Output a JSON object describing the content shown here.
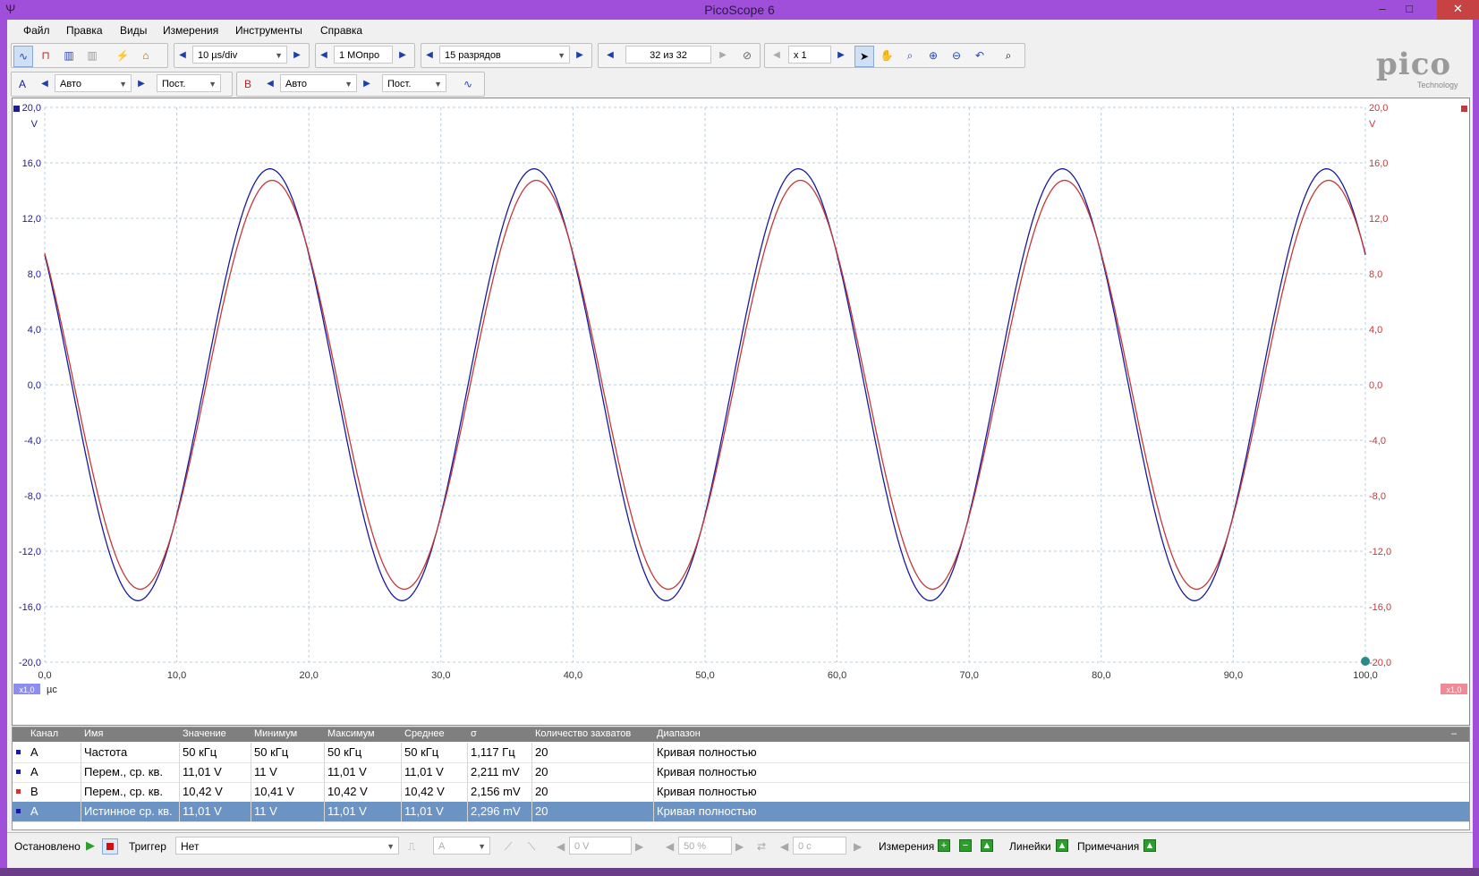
{
  "window": {
    "title": "PicoScope 6"
  },
  "menu": [
    "Файл",
    "Правка",
    "Виды",
    "Измерения",
    "Инструменты",
    "Справка"
  ],
  "toolbar1": {
    "timebase": "10 µs/div",
    "samples": "1 MОпро",
    "resolution": "15 разрядов",
    "buffer": "32 из 32",
    "zoom": "x 1"
  },
  "toolbar2": {
    "channel_a": {
      "label": "A",
      "range": "Авто",
      "coupling": "Пост."
    },
    "channel_b": {
      "label": "B",
      "range": "Авто",
      "coupling": "Пост."
    }
  },
  "logo": {
    "word": "pico",
    "sub": "Technology"
  },
  "plot": {
    "left_unit": "V",
    "right_unit": "V",
    "x_unit": "µс",
    "x_scale_left": "x1,0",
    "x_scale_right": "x1,0",
    "y_ticks": [
      "20,0",
      "16,0",
      "12,0",
      "8,0",
      "4,0",
      "0,0",
      "-4,0",
      "-8,0",
      "-12,0",
      "-16,0",
      "-20,0"
    ],
    "x_ticks": [
      "0,0",
      "10,0",
      "20,0",
      "30,0",
      "40,0",
      "50,0",
      "60,0",
      "70,0",
      "80,0",
      "90,0",
      "100,0"
    ],
    "colors": {
      "channel_a": "#1a1a9c",
      "channel_b": "#c23a3a",
      "grid": "#b8ccd8"
    }
  },
  "chart_data": {
    "type": "line",
    "title": "",
    "xlabel": "µс",
    "ylabel": "V",
    "xlim": [
      0,
      100
    ],
    "ylim": [
      -20,
      20
    ],
    "grid": true,
    "series": [
      {
        "name": "A",
        "color": "#1a1a9c",
        "amplitude": 15.57,
        "frequency_khz": 50,
        "phase_deg": 143,
        "offset": 0
      },
      {
        "name": "B",
        "color": "#c23a3a",
        "amplitude": 14.74,
        "frequency_khz": 50,
        "phase_deg": 140,
        "offset": 0
      }
    ]
  },
  "table": {
    "headers": [
      "Канал",
      "Имя",
      "Значение",
      "Минимум",
      "Максимум",
      "Среднее",
      "σ",
      "Количество захватов",
      "Диапазон"
    ],
    "rows": [
      {
        "channel": "A",
        "name": "Частота",
        "value": "50 кГц",
        "min": "50 кГц",
        "max": "50 кГц",
        "avg": "50 кГц",
        "sigma": "1,117 Гц",
        "count": "20",
        "range": "Кривая полностью",
        "color": "#1a1a9c",
        "selected": false
      },
      {
        "channel": "A",
        "name": "Перем., ср. кв.",
        "value": "11,01 V",
        "min": "11 V",
        "max": "11,01 V",
        "avg": "11,01 V",
        "sigma": "2,211 mV",
        "count": "20",
        "range": "Кривая полностью",
        "color": "#1a1a9c",
        "selected": false
      },
      {
        "channel": "B",
        "name": "Перем., ср. кв.",
        "value": "10,42 V",
        "min": "10,41 V",
        "max": "10,42 V",
        "avg": "10,42 V",
        "sigma": "2,156 mV",
        "count": "20",
        "range": "Кривая полностью",
        "color": "#c23a3a",
        "selected": false
      },
      {
        "channel": "A",
        "name": "Истинное ср. кв.",
        "value": "11,01 V",
        "min": "11 V",
        "max": "11,01 V",
        "avg": "11,01 V",
        "sigma": "2,296 mV",
        "count": "20",
        "range": "Кривая полностью",
        "color": "#1a1a9c",
        "selected": true
      }
    ]
  },
  "status": {
    "state": "Остановлено",
    "trigger_label": "Триггер",
    "trigger_mode": "Нет",
    "trigger_source": "A",
    "trigger_level": "0 V",
    "pretrigger": "50 %",
    "delay": "0 с",
    "measurements": "Измерения",
    "rulers": "Линейки",
    "notes": "Примечания"
  }
}
